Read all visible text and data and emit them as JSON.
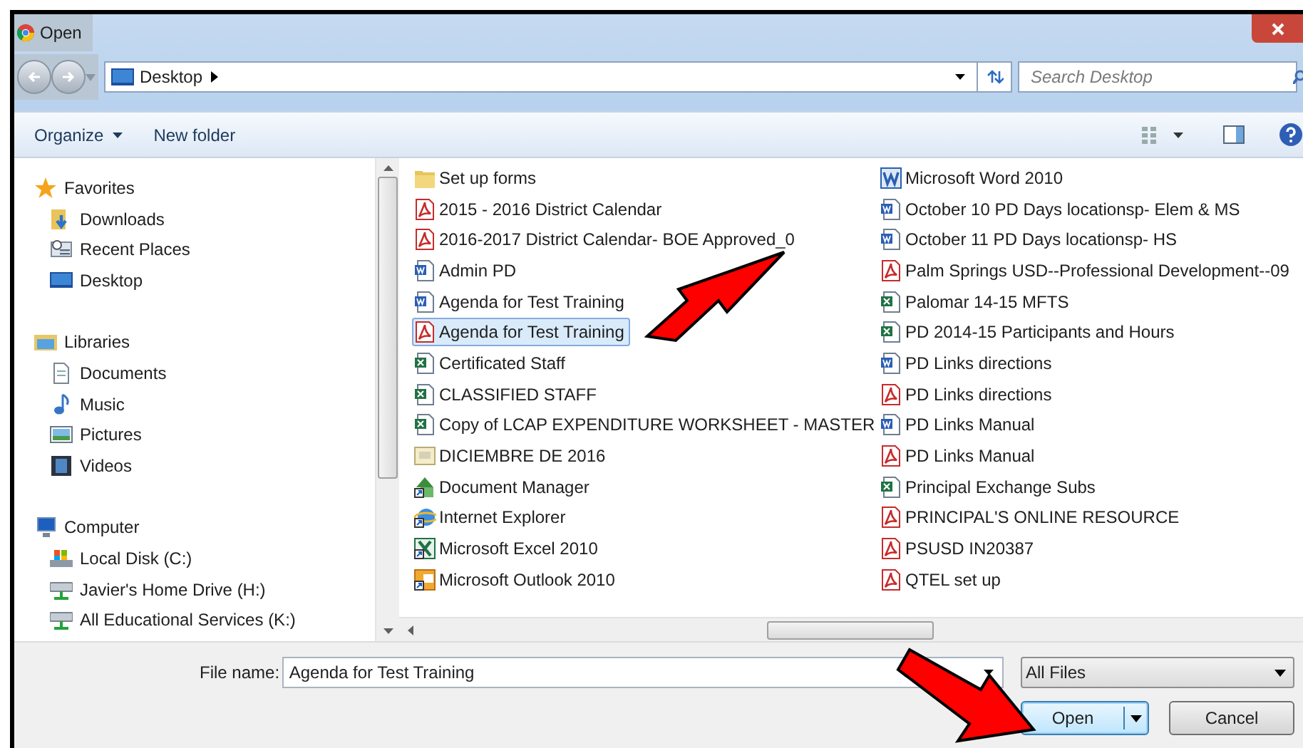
{
  "window": {
    "title": "Open"
  },
  "address_bar": {
    "path": "Desktop"
  },
  "search": {
    "placeholder": "Search Desktop"
  },
  "toolbar": [
    {
      "label": "Organize",
      "dropdown": true
    },
    {
      "label": "New folder",
      "dropdown": false
    }
  ],
  "navigation": [
    {
      "label": "Favorites",
      "kind": "star",
      "children": [
        {
          "label": "Downloads",
          "kind": "downloads"
        },
        {
          "label": "Recent Places",
          "kind": "recent"
        },
        {
          "label": "Desktop",
          "kind": "desktop"
        }
      ]
    },
    {
      "label": "Libraries",
      "kind": "library",
      "children": [
        {
          "label": "Documents",
          "kind": "document"
        },
        {
          "label": "Music",
          "kind": "music"
        },
        {
          "label": "Pictures",
          "kind": "pictures"
        },
        {
          "label": "Videos",
          "kind": "videos"
        }
      ]
    },
    {
      "label": "Computer",
      "kind": "computer",
      "children": [
        {
          "label": "Local Disk (C:)",
          "kind": "disk"
        },
        {
          "label": "Javier's Home Drive (H:)",
          "kind": "network"
        },
        {
          "label": "All Educational Services (K:)",
          "kind": "network"
        }
      ]
    }
  ],
  "files": [
    {
      "name": "Set up forms",
      "kind": "folder",
      "selected": false
    },
    {
      "name": "2015 - 2016 District Calendar",
      "kind": "pdf",
      "selected": false
    },
    {
      "name": "2016-2017 District Calendar- BOE Approved_0",
      "kind": "pdf",
      "selected": false
    },
    {
      "name": "Admin PD",
      "kind": "word",
      "selected": false
    },
    {
      "name": "Agenda for Test Training",
      "kind": "word",
      "selected": false
    },
    {
      "name": "Agenda for Test Training",
      "kind": "pdf",
      "selected": true
    },
    {
      "name": "Certificated Staff",
      "kind": "excel",
      "selected": false
    },
    {
      "name": "CLASSIFIED STAFF",
      "kind": "excel",
      "selected": false
    },
    {
      "name": "Copy of LCAP EXPENDITURE WORKSHEET - MASTER",
      "kind": "excel",
      "selected": false
    },
    {
      "name": "DICIEMBRE DE 2016",
      "kind": "image",
      "selected": false
    },
    {
      "name": "Document Manager",
      "kind": "manager",
      "selected": false
    },
    {
      "name": "Internet Explorer",
      "kind": "browser",
      "selected": false
    },
    {
      "name": "Microsoft Excel 2010",
      "kind": "excel-app",
      "selected": false
    },
    {
      "name": "Microsoft Outlook 2010",
      "kind": "outlook-app",
      "selected": false
    },
    {
      "name": "Microsoft Word 2010",
      "kind": "word-app",
      "selected": false
    },
    {
      "name": "October 10 PD Days locationsp- Elem & MS",
      "kind": "word",
      "selected": false
    },
    {
      "name": "October 11 PD Days locationsp- HS",
      "kind": "word",
      "selected": false
    },
    {
      "name": "Palm Springs USD--Professional Development--09",
      "kind": "pdf",
      "selected": false
    },
    {
      "name": "Palomar 14-15 MFTS",
      "kind": "excel",
      "selected": false
    },
    {
      "name": "PD 2014-15 Participants and Hours",
      "kind": "excel",
      "selected": false
    },
    {
      "name": "PD Links directions",
      "kind": "word",
      "selected": false
    },
    {
      "name": "PD Links directions",
      "kind": "pdf",
      "selected": false
    },
    {
      "name": "PD Links Manual",
      "kind": "word",
      "selected": false
    },
    {
      "name": "PD Links Manual",
      "kind": "pdf",
      "selected": false
    },
    {
      "name": "Principal Exchange Subs",
      "kind": "excel",
      "selected": false
    },
    {
      "name": "PRINCIPAL'S ONLINE RESOURCE",
      "kind": "pdf",
      "selected": false
    },
    {
      "name": "PSUSD IN20387",
      "kind": "pdf",
      "selected": false
    },
    {
      "name": "QTEL set up",
      "kind": "pdf",
      "selected": false
    }
  ],
  "file_name": {
    "label": "File name:",
    "value": "Agenda for Test Training"
  },
  "file_type": {
    "value": "All Files"
  },
  "buttons": [
    {
      "label": "Open",
      "kind": "split"
    },
    {
      "label": "Cancel",
      "kind": "plain"
    }
  ]
}
